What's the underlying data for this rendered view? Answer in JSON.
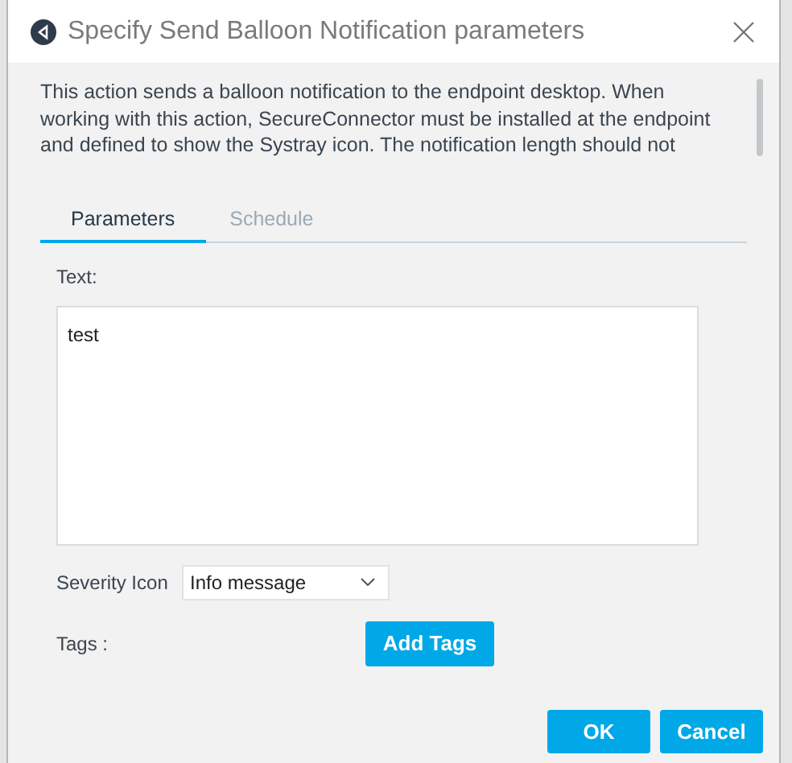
{
  "window": {
    "title": "Specify Send Balloon Notification parameters"
  },
  "description": "This action sends a balloon notification to the endpoint desktop. When working with this action, SecureConnector must be installed at the endpoint and defined to show the Systray icon. The notification length should not",
  "tabs": [
    {
      "label": "Parameters",
      "selected": true
    },
    {
      "label": "Schedule",
      "selected": false
    }
  ],
  "text_field": {
    "label": "Text:",
    "value": "test"
  },
  "severity": {
    "label": "Severity Icon",
    "value": "Info message"
  },
  "tags": {
    "label": "Tags :",
    "button": "Add Tags"
  },
  "buttons": [
    "OK",
    "Cancel"
  ]
}
